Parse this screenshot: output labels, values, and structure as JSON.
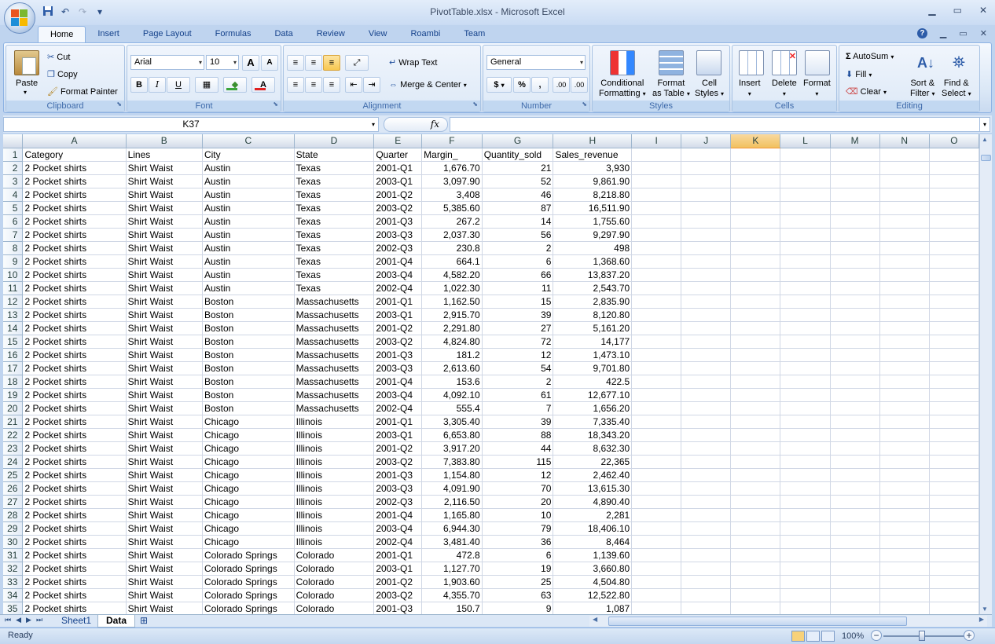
{
  "window": {
    "title": "PivotTable.xlsx - Microsoft Excel",
    "minimize": "▁",
    "maximize": "▭",
    "close": "✕"
  },
  "qat": {
    "save": "💾",
    "undo": "↶",
    "redo": "↷",
    "customize": "▾"
  },
  "tabs": [
    "Home",
    "Insert",
    "Page Layout",
    "Formulas",
    "Data",
    "Review",
    "View",
    "Roambi",
    "Team"
  ],
  "ribbon": {
    "clipboard": {
      "label": "Clipboard",
      "paste": "Paste",
      "cut": "Cut",
      "copy": "Copy",
      "format_painter": "Format Painter"
    },
    "font": {
      "label": "Font",
      "name": "Arial",
      "size": "10",
      "grow": "A",
      "shrink": "A",
      "bold": "B",
      "italic": "I",
      "underline": "U"
    },
    "alignment": {
      "label": "Alignment",
      "wrap_text": "Wrap Text",
      "merge_center": "Merge & Center"
    },
    "number": {
      "label": "Number",
      "format": "General",
      "currency": "$",
      "percent": "%",
      "comma": ",",
      "inc_decimal": ".00",
      "dec_decimal": ".00"
    },
    "styles": {
      "label": "Styles",
      "conditional": "Conditional",
      "formatting": "Formatting",
      "format_as": "Format",
      "as_table": "as Table",
      "cell": "Cell",
      "cell_styles": "Styles"
    },
    "cells": {
      "label": "Cells",
      "insert": "Insert",
      "delete": "Delete",
      "format": "Format"
    },
    "editing": {
      "label": "Editing",
      "autosum": "AutoSum",
      "fill": "Fill",
      "clear": "Clear",
      "sort": "Sort &",
      "filter": "Filter",
      "find": "Find &",
      "select": "Select"
    }
  },
  "formula_bar": {
    "name_box": "K37",
    "fx": "fx",
    "value": ""
  },
  "columns": [
    "A",
    "B",
    "C",
    "D",
    "E",
    "F",
    "G",
    "H",
    "I",
    "J",
    "K",
    "L",
    "M",
    "N",
    "O"
  ],
  "selected_column": "K",
  "rows": [
    [
      "Category",
      "Lines",
      "City",
      "State",
      "Quarter",
      "Margin_",
      "Quantity_sold",
      "Sales_revenue"
    ],
    [
      "2 Pocket shirts",
      "Shirt Waist",
      "Austin",
      "Texas",
      "2001-Q1",
      "1,676.70",
      "21",
      "3,930"
    ],
    [
      "2 Pocket shirts",
      "Shirt Waist",
      "Austin",
      "Texas",
      "2003-Q1",
      "3,097.90",
      "52",
      "9,861.90"
    ],
    [
      "2 Pocket shirts",
      "Shirt Waist",
      "Austin",
      "Texas",
      "2001-Q2",
      "3,408",
      "46",
      "8,218.80"
    ],
    [
      "2 Pocket shirts",
      "Shirt Waist",
      "Austin",
      "Texas",
      "2003-Q2",
      "5,385.60",
      "87",
      "16,511.90"
    ],
    [
      "2 Pocket shirts",
      "Shirt Waist",
      "Austin",
      "Texas",
      "2001-Q3",
      "267.2",
      "14",
      "1,755.60"
    ],
    [
      "2 Pocket shirts",
      "Shirt Waist",
      "Austin",
      "Texas",
      "2003-Q3",
      "2,037.30",
      "56",
      "9,297.90"
    ],
    [
      "2 Pocket shirts",
      "Shirt Waist",
      "Austin",
      "Texas",
      "2002-Q3",
      "230.8",
      "2",
      "498"
    ],
    [
      "2 Pocket shirts",
      "Shirt Waist",
      "Austin",
      "Texas",
      "2001-Q4",
      "664.1",
      "6",
      "1,368.60"
    ],
    [
      "2 Pocket shirts",
      "Shirt Waist",
      "Austin",
      "Texas",
      "2003-Q4",
      "4,582.20",
      "66",
      "13,837.20"
    ],
    [
      "2 Pocket shirts",
      "Shirt Waist",
      "Austin",
      "Texas",
      "2002-Q4",
      "1,022.30",
      "11",
      "2,543.70"
    ],
    [
      "2 Pocket shirts",
      "Shirt Waist",
      "Boston",
      "Massachusetts",
      "2001-Q1",
      "1,162.50",
      "15",
      "2,835.90"
    ],
    [
      "2 Pocket shirts",
      "Shirt Waist",
      "Boston",
      "Massachusetts",
      "2003-Q1",
      "2,915.70",
      "39",
      "8,120.80"
    ],
    [
      "2 Pocket shirts",
      "Shirt Waist",
      "Boston",
      "Massachusetts",
      "2001-Q2",
      "2,291.80",
      "27",
      "5,161.20"
    ],
    [
      "2 Pocket shirts",
      "Shirt Waist",
      "Boston",
      "Massachusetts",
      "2003-Q2",
      "4,824.80",
      "72",
      "14,177"
    ],
    [
      "2 Pocket shirts",
      "Shirt Waist",
      "Boston",
      "Massachusetts",
      "2001-Q3",
      "181.2",
      "12",
      "1,473.10"
    ],
    [
      "2 Pocket shirts",
      "Shirt Waist",
      "Boston",
      "Massachusetts",
      "2003-Q3",
      "2,613.60",
      "54",
      "9,701.80"
    ],
    [
      "2 Pocket shirts",
      "Shirt Waist",
      "Boston",
      "Massachusetts",
      "2001-Q4",
      "153.6",
      "2",
      "422.5"
    ],
    [
      "2 Pocket shirts",
      "Shirt Waist",
      "Boston",
      "Massachusetts",
      "2003-Q4",
      "4,092.10",
      "61",
      "12,677.10"
    ],
    [
      "2 Pocket shirts",
      "Shirt Waist",
      "Boston",
      "Massachusetts",
      "2002-Q4",
      "555.4",
      "7",
      "1,656.20"
    ],
    [
      "2 Pocket shirts",
      "Shirt Waist",
      "Chicago",
      "Illinois",
      "2001-Q1",
      "3,305.40",
      "39",
      "7,335.40"
    ],
    [
      "2 Pocket shirts",
      "Shirt Waist",
      "Chicago",
      "Illinois",
      "2003-Q1",
      "6,653.80",
      "88",
      "18,343.20"
    ],
    [
      "2 Pocket shirts",
      "Shirt Waist",
      "Chicago",
      "Illinois",
      "2001-Q2",
      "3,917.20",
      "44",
      "8,632.30"
    ],
    [
      "2 Pocket shirts",
      "Shirt Waist",
      "Chicago",
      "Illinois",
      "2003-Q2",
      "7,383.80",
      "115",
      "22,365"
    ],
    [
      "2 Pocket shirts",
      "Shirt Waist",
      "Chicago",
      "Illinois",
      "2001-Q3",
      "1,154.80",
      "12",
      "2,462.40"
    ],
    [
      "2 Pocket shirts",
      "Shirt Waist",
      "Chicago",
      "Illinois",
      "2003-Q3",
      "4,091.90",
      "70",
      "13,615.30"
    ],
    [
      "2 Pocket shirts",
      "Shirt Waist",
      "Chicago",
      "Illinois",
      "2002-Q3",
      "2,116.50",
      "20",
      "4,890.40"
    ],
    [
      "2 Pocket shirts",
      "Shirt Waist",
      "Chicago",
      "Illinois",
      "2001-Q4",
      "1,165.80",
      "10",
      "2,281"
    ],
    [
      "2 Pocket shirts",
      "Shirt Waist",
      "Chicago",
      "Illinois",
      "2003-Q4",
      "6,944.30",
      "79",
      "18,406.10"
    ],
    [
      "2 Pocket shirts",
      "Shirt Waist",
      "Chicago",
      "Illinois",
      "2002-Q4",
      "3,481.40",
      "36",
      "8,464"
    ],
    [
      "2 Pocket shirts",
      "Shirt Waist",
      "Colorado Springs",
      "Colorado",
      "2001-Q1",
      "472.8",
      "6",
      "1,139.60"
    ],
    [
      "2 Pocket shirts",
      "Shirt Waist",
      "Colorado Springs",
      "Colorado",
      "2003-Q1",
      "1,127.70",
      "19",
      "3,660.80"
    ],
    [
      "2 Pocket shirts",
      "Shirt Waist",
      "Colorado Springs",
      "Colorado",
      "2001-Q2",
      "1,903.60",
      "25",
      "4,504.80"
    ],
    [
      "2 Pocket shirts",
      "Shirt Waist",
      "Colorado Springs",
      "Colorado",
      "2003-Q2",
      "4,355.70",
      "63",
      "12,522.80"
    ],
    [
      "2 Pocket shirts",
      "Shirt Waist",
      "Colorado Springs",
      "Colorado",
      "2001-Q3",
      "150.7",
      "9",
      "1,087"
    ]
  ],
  "sheets": [
    "Sheet1",
    "Data"
  ],
  "active_sheet": "Data",
  "status": {
    "ready": "Ready",
    "zoom": "100%"
  }
}
